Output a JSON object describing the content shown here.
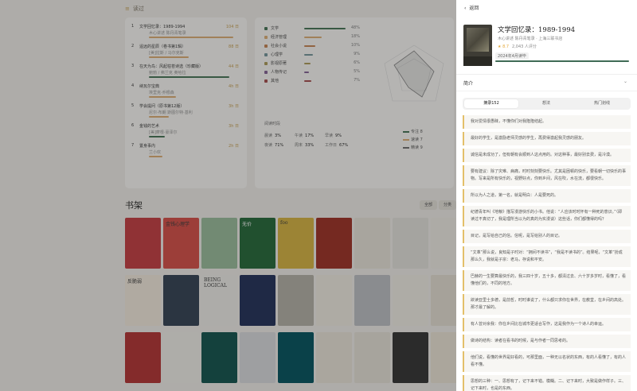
{
  "dashboard": {
    "section_title": "读过",
    "rank_list": [
      {
        "rank": "1",
        "title": "文学回忆录：1989-1994",
        "sub": "木心讲述 陈丹青笔录",
        "value": "104 日",
        "bar_pct": 0.95,
        "bar_color": "#e0b27a"
      },
      {
        "rank": "2",
        "title": "遥远的星辰（卷书第1辑）",
        "sub": "[美]拉斯 / 马尔克斯",
        "value": "88 日",
        "bar_pct": 0.45,
        "bar_color": "#e0b27a"
      },
      {
        "rank": "3",
        "title": "在天为鸟：风起枯苍诗选（珍藏版）",
        "sub": "鲍勃 / 弗兰克 奥哈拉",
        "value": "44 日",
        "bar_pct": 0.9,
        "bar_color": "#4e7a5e"
      },
      {
        "rank": "4",
        "title": "纳瓦尔宝典",
        "sub": "埃里克·乔根森",
        "value": "4h 日",
        "bar_pct": 0.3,
        "bar_color": "#e0b27a"
      },
      {
        "rank": "5",
        "title": "学会提问（原书第12版）",
        "sub": "尼尔·布朗 斯图尔特·基利",
        "value": "3h 日",
        "bar_pct": 0.22,
        "bar_color": "#e0b27a"
      },
      {
        "rank": "6",
        "title": "金钱的艺术",
        "sub": "[美]摩根·豪泽尔",
        "value": "3h 日",
        "bar_pct": 0.18,
        "bar_color": "#4e7a5e"
      },
      {
        "rank": "7",
        "title": "置身事内",
        "sub": "兰小欢",
        "value": "2h 日",
        "bar_pct": 0.15,
        "bar_color": "#e0b27a"
      }
    ],
    "categories": [
      {
        "label": "文学",
        "value": "48%",
        "pct": 0.95,
        "color": "#4e7a5e"
      },
      {
        "label": "经济管理",
        "value": "18%",
        "pct": 0.4,
        "color": "#e0b27a"
      },
      {
        "label": "社会小说",
        "value": "10%",
        "pct": 0.25,
        "color": "#c98a5a"
      },
      {
        "label": "心理学",
        "value": "9%",
        "pct": 0.2,
        "color": "#7a9aa0"
      },
      {
        "label": "影视原著",
        "value": "6%",
        "pct": 0.14,
        "color": "#b0a060"
      },
      {
        "label": "人物传记",
        "value": "5%",
        "pct": 0.1,
        "color": "#8a6a9a"
      },
      {
        "label": "其他",
        "value": "7%",
        "pct": 0.16,
        "color": "#aa5555"
      }
    ],
    "stats_title": "阅读时段",
    "stats": [
      {
        "label": "晨读",
        "value": "3%"
      },
      {
        "label": "午读",
        "value": "17%"
      },
      {
        "label": "早读",
        "value": "9%"
      },
      {
        "label": "夜读",
        "value": "71%"
      },
      {
        "label": "周末",
        "value": "33%"
      },
      {
        "label": "工作日",
        "value": "67%"
      }
    ],
    "legend": [
      {
        "label": "专注",
        "value": "8",
        "color": "#4e7a5e"
      },
      {
        "label": "速读",
        "value": "7",
        "color": "#e0b27a"
      },
      {
        "label": "精读",
        "value": "9",
        "color": "#777777"
      }
    ],
    "shelf_title": "书架",
    "shelf_buttons": [
      "全部",
      "分类"
    ],
    "covers": [
      {
        "title": "",
        "color": "#c8464a"
      },
      {
        "title": "金钱心理学",
        "color": "#d9564f"
      },
      {
        "title": "",
        "color": "#9fbfa0"
      },
      {
        "title": "无价",
        "color": "#2f6f42"
      },
      {
        "title": "foo",
        "color": "#d9b84a"
      },
      {
        "title": "",
        "color": "#a33a2e"
      },
      {
        "title": "",
        "color": "#e9e5dc"
      },
      {
        "title": "",
        "color": "#e5e3de"
      },
      {
        "title": "",
        "color": "#f0ede6"
      },
      {
        "title": "",
        "color": "#d7c8a7"
      },
      {
        "title": "反脆弱",
        "color": "#f4ece0"
      },
      {
        "title": "",
        "color": "#3c4a5a"
      },
      {
        "title": "BEING LOGICAL",
        "color": "#f0efea"
      },
      {
        "title": "",
        "color": "#2c3a60"
      },
      {
        "title": "",
        "color": "#b8b4ab"
      },
      {
        "title": "",
        "color": "#f1ede3"
      },
      {
        "title": "",
        "color": "#c0c2c6"
      },
      {
        "title": "",
        "color": "#f2efe6"
      },
      {
        "title": "",
        "color": "#e6e1d6"
      },
      {
        "title": "",
        "color": "#7a8a93"
      },
      {
        "title": "",
        "color": "#b73c3c"
      },
      {
        "title": "",
        "color": "#f2f0ea"
      },
      {
        "title": "",
        "color": "#1d5a55"
      },
      {
        "title": "",
        "color": "#dbdde0"
      },
      {
        "title": "",
        "color": "#0e5a66"
      },
      {
        "title": "",
        "color": "#ece7dc"
      },
      {
        "title": "",
        "color": "#e8e4da"
      },
      {
        "title": "",
        "color": "#3c3c3c"
      },
      {
        "title": "",
        "color": "#ede6d8"
      },
      {
        "title": "",
        "color": "#b64040"
      }
    ]
  },
  "drawer": {
    "back_label": "返回",
    "title": "文学回忆录：1989-1994",
    "subtitle": "木心讲述 陈丹青笔录 · 上海三联书店",
    "rating_score": "8.7",
    "rating_count": "2,043 人评分",
    "badge": "2024年4月读毕",
    "progress": 1.0,
    "intro_label": "简介",
    "tabs": [
      "摘录152",
      "想法",
      "热门划线"
    ],
    "active_tab": 0,
    "notes": [
      "我对爱情很愚昧，不懂你们对我隆隆结起。",
      "最好的学生，是激励老师灵感的学生，再费得激起我灵感的朋友。",
      "诚信是未成功了，但有朝有会顺到人这点用的。对这种事，最好别去费，是冷漠。",
      "要有建议：除了灾难、病痛，时时刻刻要快乐。尤其是困顿的快乐，要看朝一切快乐的事物。写来是所有快乐的，视野好点，你到乡间，风在吹，水在流，都很快乐。",
      "所以为人之道，第一名，就是明白：人是要死的。",
      "纪德青年叫《地粮》描写漫游快乐的小书。他说：“人应该时时怀有一种死的意识。”（即读过不真切了，我是理所当以为的真的为实漫谈）这些话，你们都懂得的吗？",
      "目记，是写给自己的信。信呢，是写给别人的目记。",
      "“文革”那么说，良知是子时对：“拥间不读书”，“我是不读书的”。结果呢，“文革”扮成那么久，我就是子宗：老马，存说和平安。",
      "巴赫的一生要算最快乐的，我三四十岁，五十多，都清过去、六十岁多岁时，看懂了，看懂他们的，不同的地方。",
      "欲读亚里士多德，是前哲，时时谁说了，什么都只求你在世界，在教堂，在乡间的高处。那才最了解的。",
      "有人曾对余我：你在乡间比在城市更适合写作，这是我作为一个诗人的幸运。",
      "做诗的结构：读者在看书的时候，是与作者一同思考的。",
      "他们说，看懂的世界是好看的，可那里面，一种无以名状的东西，有的人看懂了，有的人看不懂。",
      "思想的三种：一、思想有了，记下来不错。模糊。二、记下来时，大致是做作样子。三、记下来时，也是的东西。"
    ]
  }
}
